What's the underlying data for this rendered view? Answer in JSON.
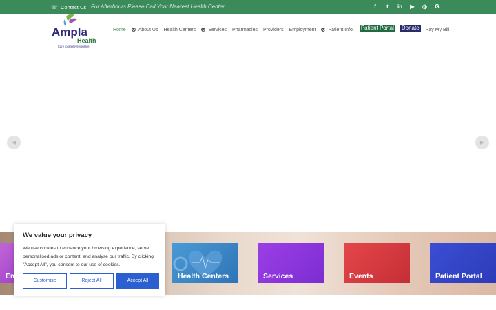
{
  "topbar": {
    "phone_icon": "phone-icon",
    "contact_label": "Contact Us",
    "notice": "For Afterhours Please Call Your Nearest Health Center",
    "social": [
      {
        "icon": "facebook-icon",
        "glyph": "f"
      },
      {
        "icon": "twitter-icon",
        "glyph": "t"
      },
      {
        "icon": "linkedin-icon",
        "glyph": "in"
      },
      {
        "icon": "youtube-icon",
        "glyph": "▶"
      },
      {
        "icon": "instagram-icon",
        "glyph": "◎"
      },
      {
        "icon": "google-icon",
        "glyph": "G"
      }
    ]
  },
  "logo": {
    "name": "Ampla",
    "sub": "Health",
    "tagline": "Care to improve your life."
  },
  "nav": {
    "home": "Home",
    "about": "About Us",
    "health_centers": "Health Centers",
    "services": "Services",
    "pharmacies": "Pharmacies",
    "providers": "Providers",
    "employment": "Employment",
    "patient_info": "Patient Info.",
    "patient_portal": "Patient Portal",
    "donate": "Donate",
    "pay_bill": "Pay My Bill"
  },
  "tiles": {
    "employment": "Em",
    "health_centers": "Health Centers",
    "services": "Services",
    "events": "Events",
    "patient_portal": "Patient Portal"
  },
  "cookie": {
    "title": "We value your privacy",
    "text": "We use cookies to enhance your browsing experience, serve personalised ads or content, and analyse our traffic. By clicking \"Accept All\", you consent to our use of cookies.",
    "customise": "Customise",
    "reject": "Reject All",
    "accept": "Accept All"
  },
  "colors": {
    "topbar": "#3a8a5a",
    "nav_active": "#3a8a5a",
    "portal_pill": "#1f6a3e",
    "donate_pill": "#2a2a6a",
    "cookie_button": "#2c5fd0"
  }
}
